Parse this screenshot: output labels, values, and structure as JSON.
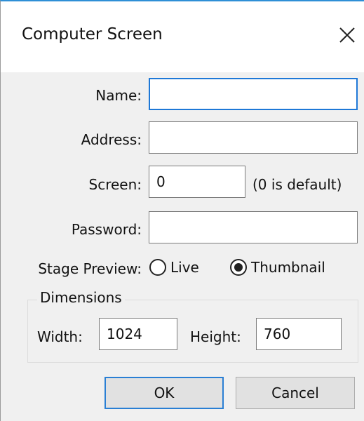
{
  "window": {
    "title": "Computer Screen"
  },
  "form": {
    "name_label": "Name:",
    "name_value": "",
    "address_label": "Address:",
    "address_value": "",
    "screen_label": "Screen:",
    "screen_value": "0",
    "screen_hint": "(0 is default)",
    "password_label": "Password:",
    "password_value": "",
    "stage_preview_label": "Stage Preview:",
    "stage_preview_options": [
      "Live",
      "Thumbnail"
    ],
    "stage_preview_selected": "Thumbnail"
  },
  "dimensions": {
    "group_title": "Dimensions",
    "width_label": "Width:",
    "width_value": "1024",
    "height_label": "Height:",
    "height_value": "760"
  },
  "buttons": {
    "ok": "OK",
    "cancel": "Cancel"
  },
  "icons": {
    "close": "close-icon"
  },
  "colors": {
    "accent": "#1e78d7",
    "title_bar_border": "#2e8fd6",
    "dialog_bg": "#f0f0f0"
  }
}
